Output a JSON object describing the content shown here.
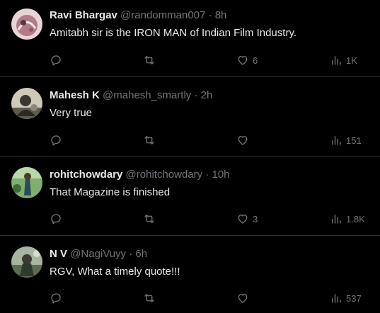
{
  "tweets": [
    {
      "name": "Ravi Bhargav",
      "handle": "@randomman007",
      "sep": "·",
      "time": "8h",
      "text": "Amitabh sir is the IRON MAN of Indian Film Industry.",
      "likes": "6",
      "views": "1K",
      "avatar_color": "#c9a2a8"
    },
    {
      "name": "Mahesh K",
      "handle": "@mahesh_smartly",
      "sep": "·",
      "time": "2h",
      "text": "Very true",
      "likes": "",
      "views": "151",
      "avatar_color": "#6b6a5c"
    },
    {
      "name": "rohitchowdary",
      "handle": "@rohitchowdary",
      "sep": "·",
      "time": "10h",
      "text": "That Magazine is finished",
      "likes": "3",
      "views": "1.8K",
      "avatar_color": "#4d7a52"
    },
    {
      "name": "N V",
      "handle": "@NagiVuyy",
      "sep": "·",
      "time": "6h",
      "text": "RGV, What a timely quote!!!",
      "likes": "",
      "views": "537",
      "avatar_color": "#7c8a74"
    }
  ],
  "icons": {
    "reply": "reply-icon",
    "retweet": "retweet-icon",
    "like": "heart-icon",
    "views": "views-icon"
  },
  "colors": {
    "background": "#000000",
    "text": "#e7e9ea",
    "muted": "#71767b",
    "divider": "#2f3336"
  }
}
